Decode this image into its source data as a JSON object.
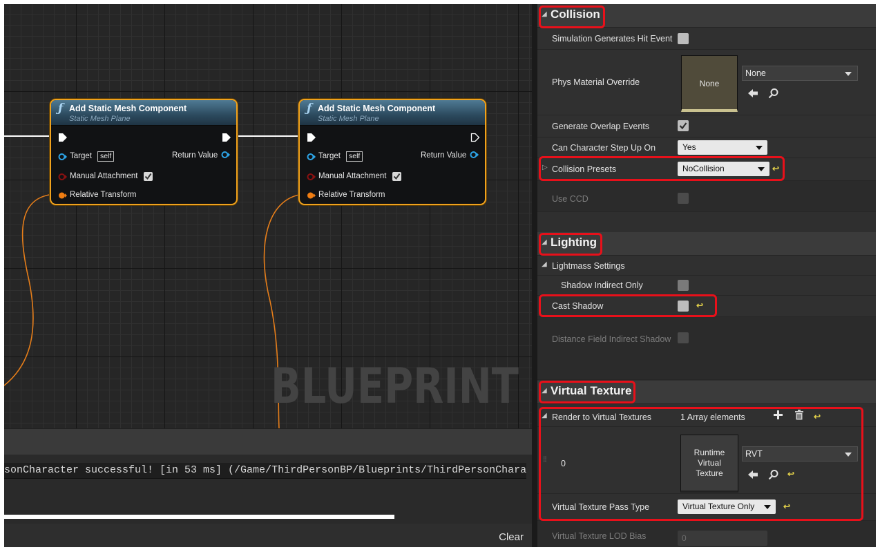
{
  "graph": {
    "watermark": "BLUEPRINT",
    "nodes": [
      {
        "title": "Add Static Mesh Component",
        "subtitle": "Static Mesh Plane",
        "target_label": "Target",
        "self_label": "self",
        "return_label": "Return Value",
        "manual_attachment_label": "Manual Attachment",
        "manual_attachment_checked": true,
        "relative_transform_label": "Relative Transform"
      },
      {
        "title": "Add Static Mesh Component",
        "subtitle": "Static Mesh Plane",
        "target_label": "Target",
        "self_label": "self",
        "return_label": "Return Value",
        "manual_attachment_label": "Manual Attachment",
        "manual_attachment_checked": true,
        "relative_transform_label": "Relative Transform"
      }
    ],
    "colors": {
      "node_border": "#f0a21e",
      "exec_wire": "#ffffff",
      "transform_wire": "#e67e1a",
      "object_pin": "#2da5e8",
      "bool_pin": "#8b1111"
    }
  },
  "log": {
    "message": "sonCharacter successful! [in 53 ms] (/Game/ThirdPersonBP/Blueprints/ThirdPersonChara",
    "progress": 0.745,
    "clear_label": "Clear"
  },
  "details": {
    "collision": {
      "title": "Collision",
      "sim_hit_label": "Simulation Generates Hit Event",
      "sim_hit_checked": false,
      "phys_mat_label": "Phys Material Override",
      "phys_mat_thumb": "None",
      "phys_mat_value": "None",
      "overlap_label": "Generate Overlap Events",
      "overlap_checked": true,
      "step_up_label": "Can Character Step Up On",
      "step_up_value": "Yes",
      "presets_label": "Collision Presets",
      "presets_value": "NoCollision",
      "ccd_label": "Use CCD"
    },
    "lighting": {
      "title": "Lighting",
      "lightmass_label": "Lightmass Settings",
      "shadow_indirect_label": "Shadow Indirect Only",
      "cast_shadow_label": "Cast Shadow",
      "cast_shadow_checked": false,
      "dfi_shadow_label": "Distance Field Indirect Shadow"
    },
    "virtual_texture": {
      "title": "Virtual Texture",
      "render_label": "Render to Virtual Textures",
      "array_count": "1 Array elements",
      "element_index": "0",
      "thumb_text": "Runtime Virtual Texture",
      "element_value": "RVT",
      "pass_type_label": "Virtual Texture Pass Type",
      "pass_type_value": "Virtual Texture Only",
      "lod_bias_label": "Virtual Texture LOD Bias",
      "lod_bias_value": "0"
    },
    "colors": {
      "highlight": "#e8101a",
      "reset_arrow": "#e3d14a"
    }
  }
}
